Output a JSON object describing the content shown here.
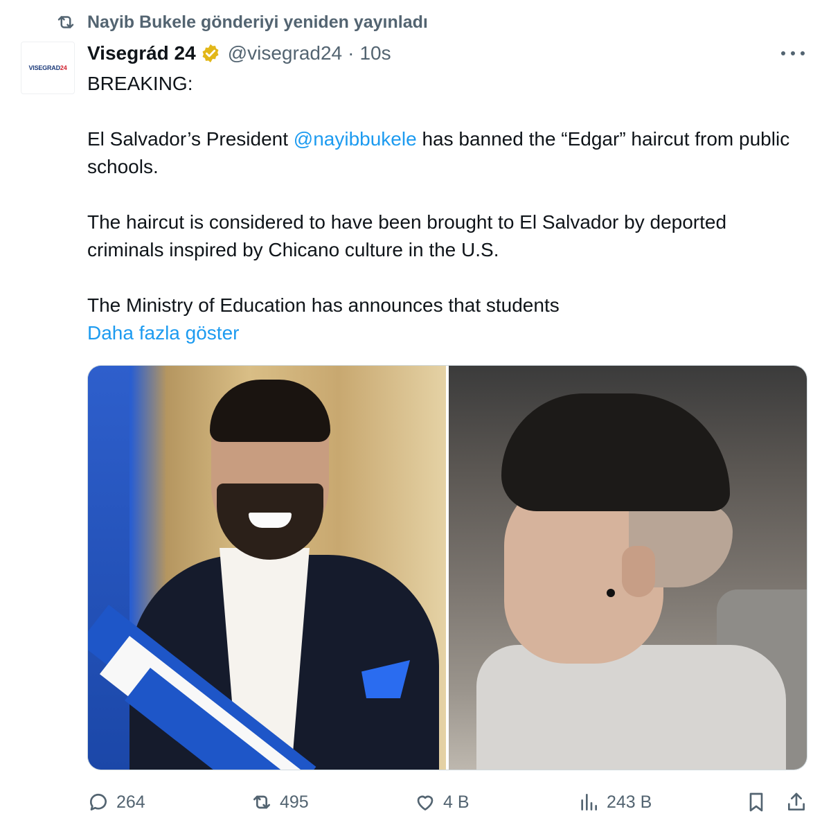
{
  "repost_banner": {
    "text": "Nayib Bukele gönderiyi yeniden yayınladı",
    "icon": "repost-icon"
  },
  "author": {
    "avatar_text_part1": "VISEGRAD",
    "avatar_text_part2": "24",
    "display_name": "Visegrád 24",
    "verified_icon": "verified-gold-badge-icon",
    "handle": "@visegrad24",
    "separator": "·",
    "time": "10s"
  },
  "tweet": {
    "line1": "BREAKING:",
    "para2_before": "El Salvador’s President ",
    "para2_mention": "@nayibbukele",
    "para2_after": " has banned the “Edgar” haircut from public schools.",
    "para3": "The haircut is considered to have been brought to El Salvador by deported criminals inspired by Chicano culture in the U.S.",
    "para4": "The Ministry of Education has announces that students",
    "show_more": "Daha fazla göster"
  },
  "media": {
    "left_photo": "portrait of man in suit with blue and white presidential sash",
    "right_photo": "side profile of young man with Edgar haircut"
  },
  "actions": {
    "replies": "264",
    "reposts": "495",
    "likes": "4 B",
    "views": "243 B"
  },
  "colors": {
    "accent": "#1d9bf0",
    "muted": "#536471",
    "text": "#0f1419"
  }
}
